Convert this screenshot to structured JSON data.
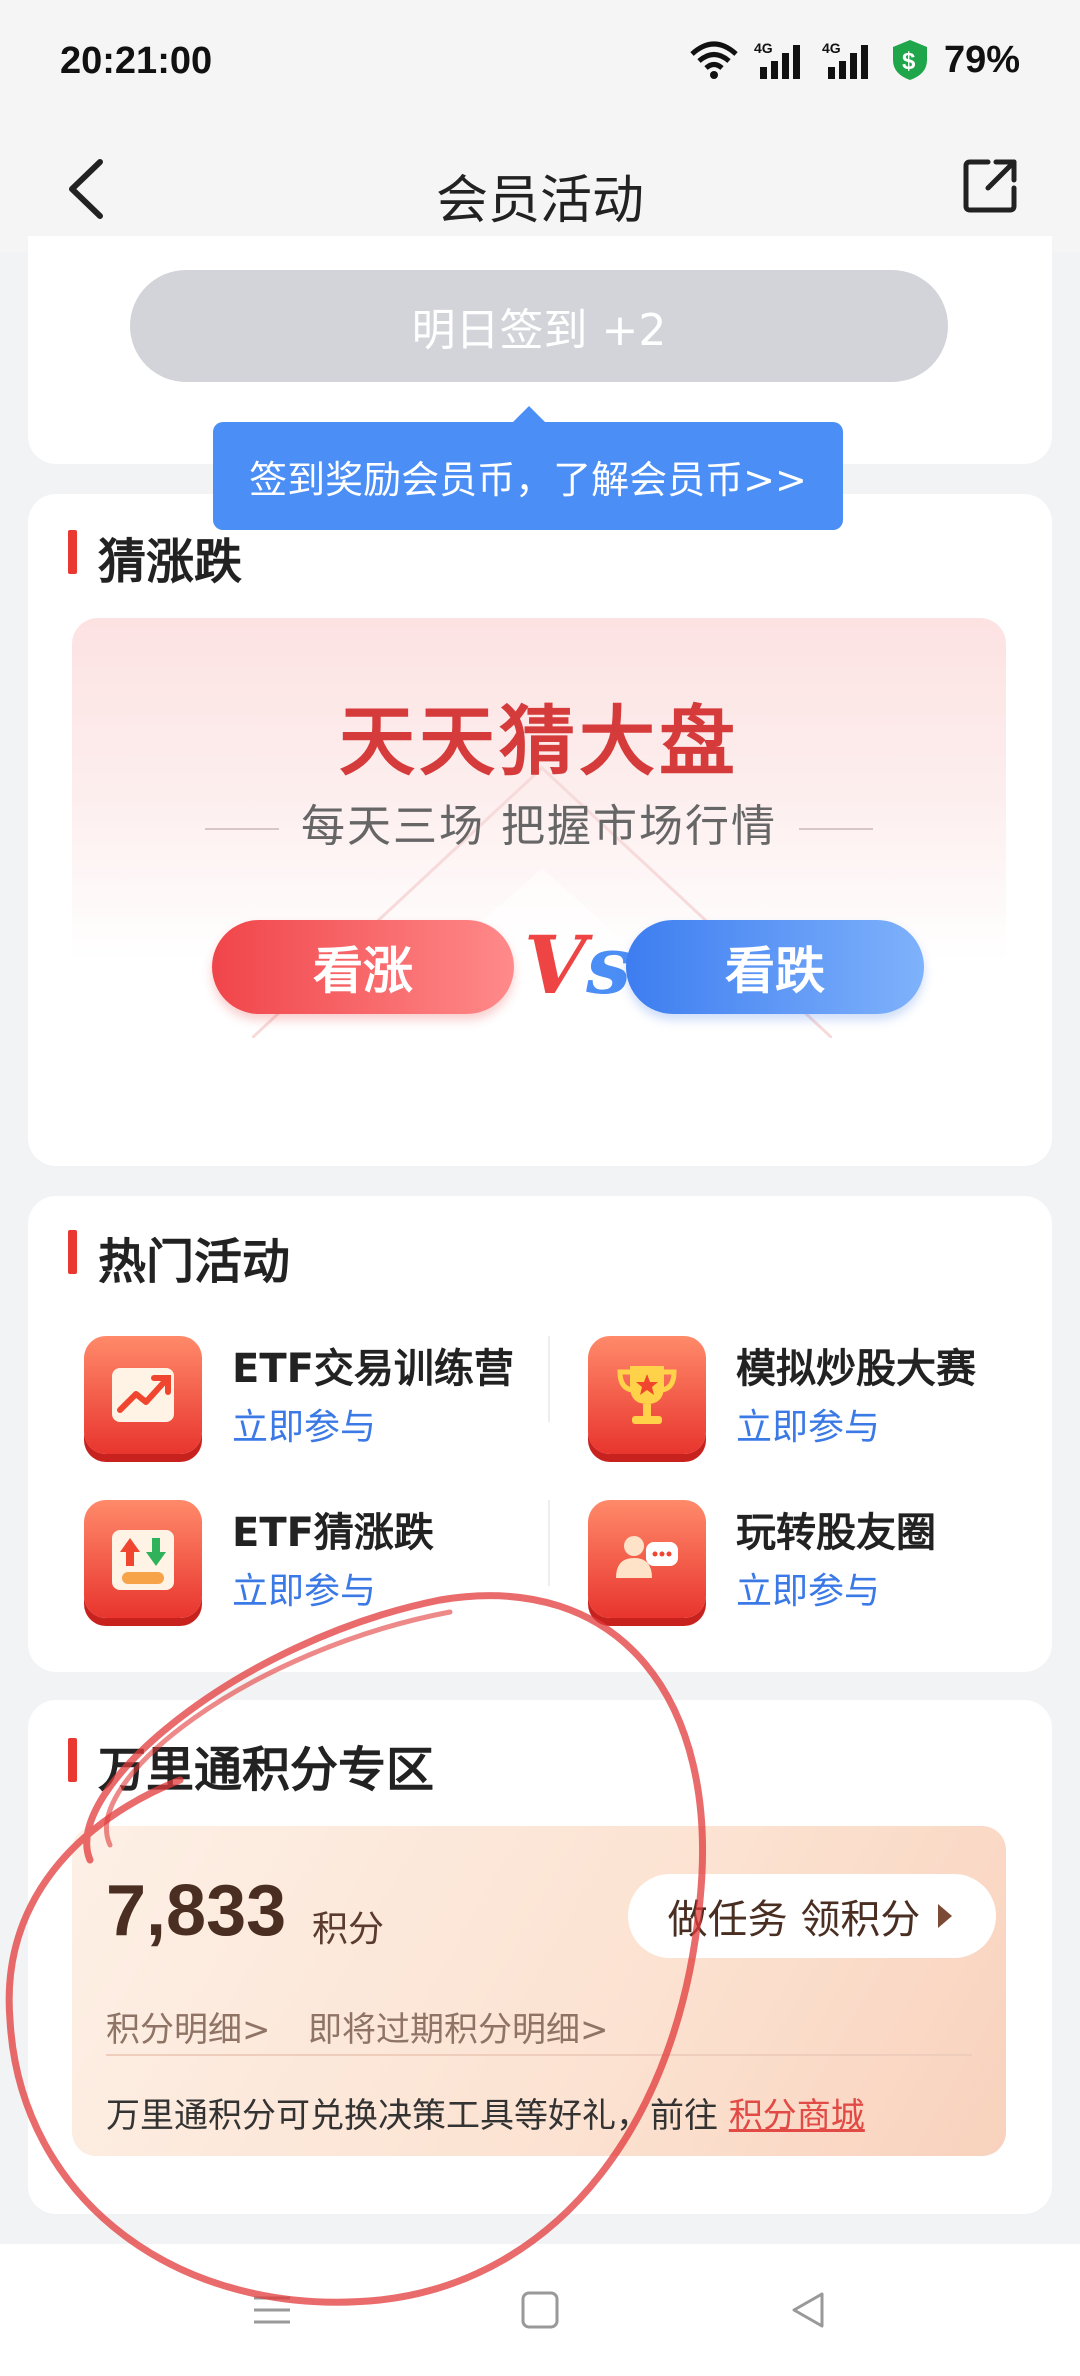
{
  "status_bar": {
    "time": "20:21:00",
    "battery": "79%",
    "network1": "4G",
    "network2": "4G"
  },
  "header": {
    "title": "会员活动"
  },
  "signin": {
    "button_label": "明日签到 +2",
    "tooltip": "签到奖励会员币，了解会员币>>"
  },
  "guess": {
    "section_title": "猜涨跌",
    "banner_title": "天天猜大盘",
    "banner_subtitle": "每天三场 把握市场行情",
    "up_label": "看涨",
    "vs_label_v": "V",
    "vs_label_s": "s",
    "down_label": "看跌"
  },
  "hot": {
    "section_title": "热门活动",
    "items": [
      {
        "name": "ETF交易训练营",
        "action": "立即参与",
        "icon": "trend-chart-icon"
      },
      {
        "name": "模拟炒股大赛",
        "action": "立即参与",
        "icon": "trophy-icon"
      },
      {
        "name": "ETF猜涨跌",
        "action": "立即参与",
        "icon": "up-down-arrows-icon"
      },
      {
        "name": "玩转股友圈",
        "action": "立即参与",
        "icon": "chat-users-icon"
      }
    ]
  },
  "points": {
    "section_title": "万里通积分专区",
    "value": "7,833",
    "unit": "积分",
    "task_button": "做任务 领积分",
    "detail_link": "积分明细>",
    "expiring_link": "即将过期积分明细>",
    "note": "万里通积分可兑换决策工具等好礼，前往 ",
    "mall_link": "积分商城"
  },
  "colors": {
    "accent_red": "#e8382f",
    "link_blue": "#3b79e6",
    "tooltip_blue": "#4b8ef5",
    "annotation_red": "#e23a3a"
  }
}
